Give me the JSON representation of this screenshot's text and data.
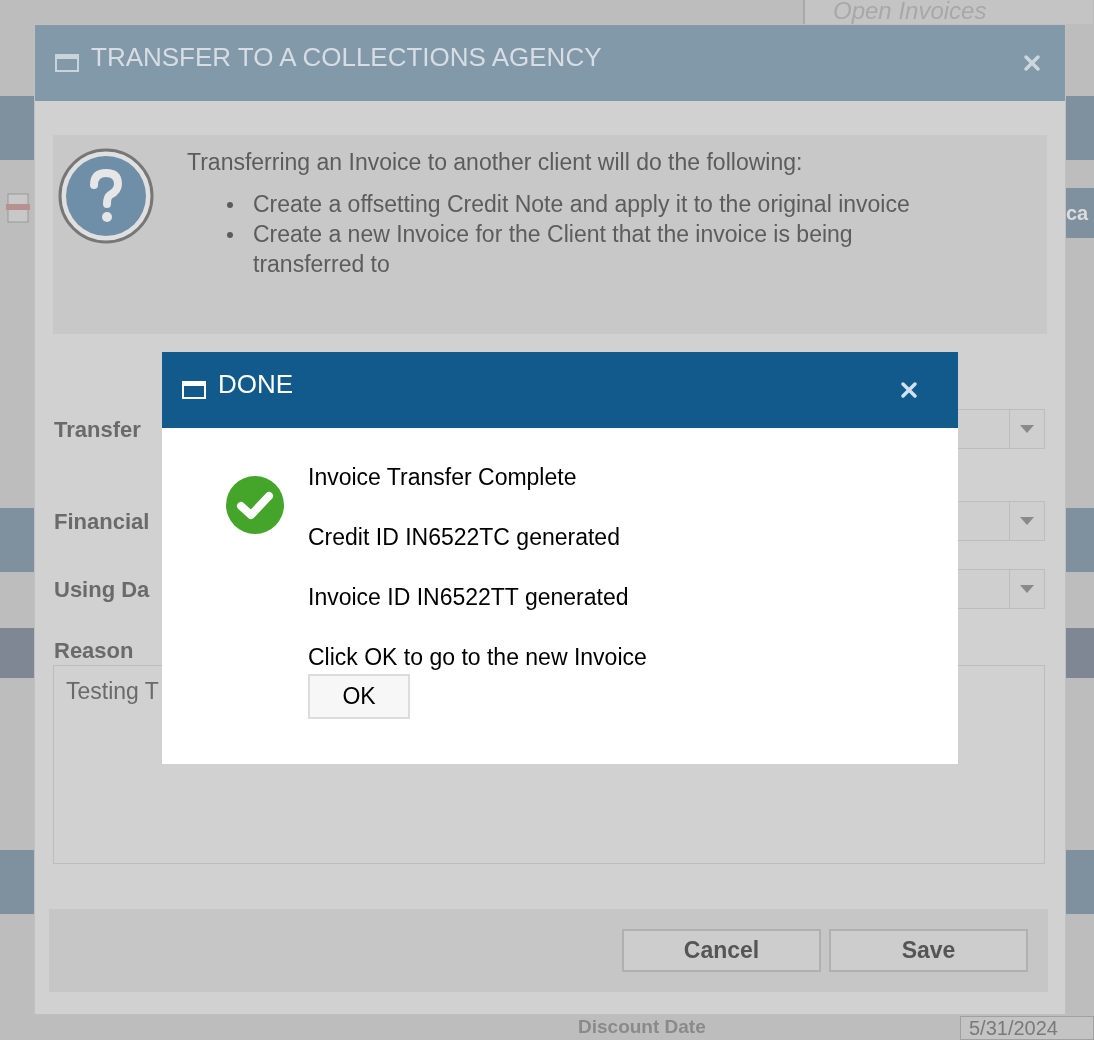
{
  "background": {
    "search": {
      "placeholder": "Open Invoices"
    },
    "side_button": "ca",
    "field_label": "Discount Date",
    "date_value": "5/31/2024"
  },
  "transfer_dialog": {
    "title": "TRANSFER TO A COLLECTIONS AGENCY",
    "intro": "Transferring an Invoice to another client will do the following:",
    "bullets": [
      "Create a offsetting Credit Note and apply it to the original invoice",
      "Create a new Invoice for the Client that the invoice is being transferred to"
    ],
    "fields": [
      {
        "kind": "select",
        "label": "Transfer"
      },
      {
        "kind": "select",
        "label": "Financial"
      },
      {
        "kind": "select",
        "label": "Using Da"
      },
      {
        "kind": "textarea",
        "label": "Reason",
        "value": "Testing T"
      }
    ],
    "buttons": [
      "Cancel",
      "Save"
    ]
  },
  "done_dialog": {
    "title": "DONE",
    "lines": [
      "Invoice Transfer Complete",
      "Credit ID IN6522TC generated",
      "Invoice ID IN6522TT generated",
      "Click OK to go to the new Invoice"
    ],
    "button": "OK"
  }
}
